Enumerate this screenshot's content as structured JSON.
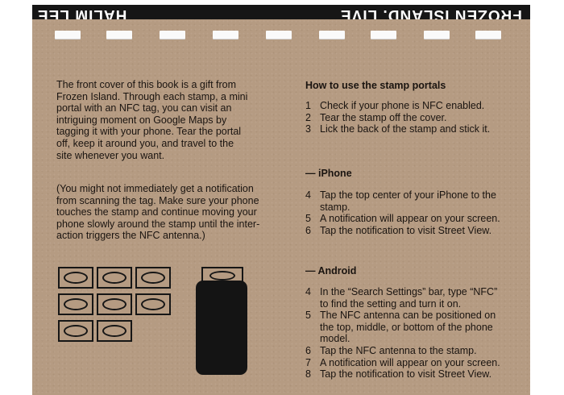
{
  "spine": {
    "author": "HALIM LEE",
    "title": "FROZEN ISLAND. LIVE"
  },
  "intro": {
    "para1_lines": [
      "The front cover of this book is a gift from",
      "Frozen Island. Through each stamp, a mini",
      "portal with an NFC tag, you can visit an",
      "intriguing moment on Google Maps by",
      "tagging it with your phone. Tear the portal",
      "off, keep it around you, and travel to the",
      "site whenever you want."
    ],
    "para2_lines": [
      "(You might not immediately get a notification",
      "from scanning the tag. Make sure your phone",
      "touches the stamp and continue moving your",
      "phone slowly around the stamp until the inter-",
      "action triggers the NFC antenna.)"
    ]
  },
  "howto": {
    "heading": "How to use the stamp portals",
    "steps": [
      {
        "n": "1",
        "text": "Check if your phone is NFC enabled."
      },
      {
        "n": "2",
        "text": "Tear the stamp off the cover."
      },
      {
        "n": "3",
        "text": "Lick the back of the stamp and stick it."
      }
    ]
  },
  "iphone": {
    "heading": "— iPhone",
    "steps": [
      {
        "n": "4",
        "lines": [
          "Tap the top center of your iPhone to the",
          "stamp."
        ]
      },
      {
        "n": "5",
        "lines": [
          "A notification will appear on your screen."
        ]
      },
      {
        "n": "6",
        "lines": [
          "Tap the notification to visit Street View."
        ]
      }
    ]
  },
  "android": {
    "heading": "— Android",
    "steps": [
      {
        "n": "4",
        "lines": [
          "In the “Search Settings” bar, type “NFC”",
          "to find the setting and turn it on."
        ]
      },
      {
        "n": "5",
        "lines": [
          "The NFC antenna can be positioned on",
          "the top, middle, or bottom of the phone",
          "model."
        ]
      },
      {
        "n": "6",
        "lines": [
          "Tap the NFC antenna to the stamp."
        ]
      },
      {
        "n": "7",
        "lines": [
          "A notification will appear on your screen."
        ]
      },
      {
        "n": "8",
        "lines": [
          "Tap the notification to visit Street View."
        ]
      }
    ]
  }
}
